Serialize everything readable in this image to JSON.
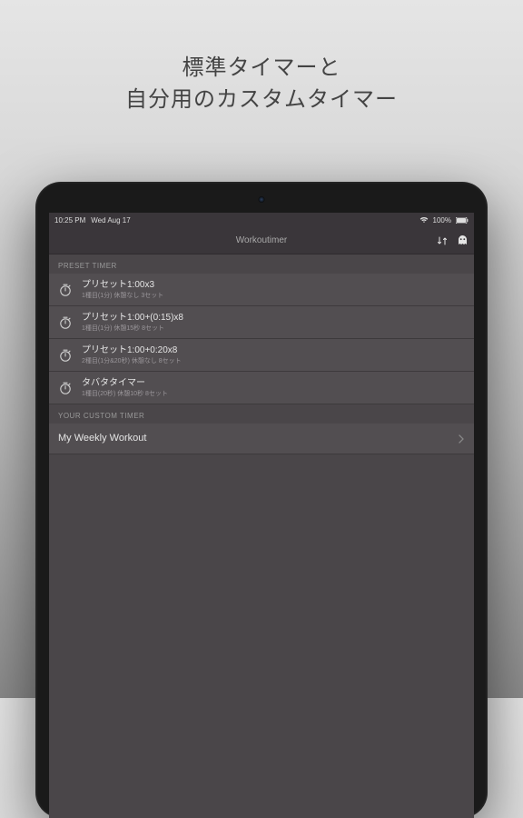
{
  "promo": {
    "line1": "標準タイマーと",
    "line2": "自分用のカスタムタイマー"
  },
  "status": {
    "time": "10:25 PM",
    "date": "Wed Aug 17",
    "battery": "100%"
  },
  "nav": {
    "title": "Workoutimer"
  },
  "sections": {
    "preset_header": "PRESET TIMER",
    "custom_header": "YOUR CUSTOM TIMER"
  },
  "preset_items": [
    {
      "title": "プリセット1:00x3",
      "sub": "1種目(1分) 休憩なし 3セット"
    },
    {
      "title": "プリセット1:00+(0:15)x8",
      "sub": "1種目(1分) 休憩15秒 8セット"
    },
    {
      "title": "プリセット1:00+0:20x8",
      "sub": "2種目(1分&20秒) 休憩なし 8セット"
    },
    {
      "title": "タバタタイマー",
      "sub": "1種目(20秒) 休憩10秒 8セット"
    }
  ],
  "custom_items": [
    {
      "title": "My Weekly Workout"
    }
  ]
}
